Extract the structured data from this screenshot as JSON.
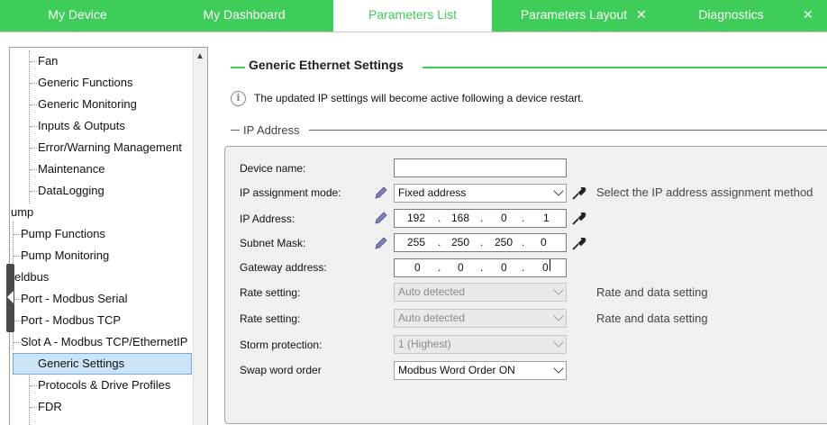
{
  "tabs": [
    {
      "label": "My Device",
      "active": false,
      "closable": false
    },
    {
      "label": "My Dashboard",
      "active": false,
      "closable": false
    },
    {
      "label": "Parameters List",
      "active": true,
      "closable": false
    },
    {
      "label": "Parameters Layout",
      "active": false,
      "closable": true
    },
    {
      "label": "Diagnostics",
      "active": false,
      "closable": true
    }
  ],
  "tree": {
    "items": [
      {
        "label": "Fan"
      },
      {
        "label": "Generic Functions"
      },
      {
        "label": "Generic Monitoring"
      },
      {
        "label": "Inputs & Outputs"
      },
      {
        "label": "Error/Warning Management"
      },
      {
        "label": "Maintenance"
      },
      {
        "label": "DataLogging"
      },
      {
        "label": "ump"
      },
      {
        "label": "Pump Functions"
      },
      {
        "label": "Pump Monitoring"
      },
      {
        "label": "eldbus"
      },
      {
        "label": "Port - Modbus Serial"
      },
      {
        "label": "Port - Modbus TCP"
      },
      {
        "label": "Slot A - Modbus TCP/EthernetIP"
      },
      {
        "label": "Generic Settings",
        "selected": true
      },
      {
        "label": "Protocols & Drive Profiles"
      },
      {
        "label": "FDR"
      }
    ]
  },
  "section": {
    "title": "Generic Ethernet Settings",
    "info": "The updated IP settings will become active following a device restart.",
    "subsection": "IP Address"
  },
  "form": {
    "device_name": {
      "label": "Device name:",
      "value": ""
    },
    "ip_mode": {
      "label": "IP assignment mode:",
      "value": "Fixed address",
      "hint": "Select the IP address assignment method"
    },
    "ip_address": {
      "label": "IP Address:",
      "octets": [
        "192",
        "168",
        "0",
        "1"
      ]
    },
    "subnet": {
      "label": "Subnet Mask:",
      "octets": [
        "255",
        "250",
        "250",
        "0"
      ]
    },
    "gateway": {
      "label": "Gateway address:",
      "octets": [
        "0",
        "0",
        "0",
        "0"
      ]
    },
    "rate1": {
      "label": "Rate setting:",
      "value": "Auto detected",
      "hint": "Rate and data setting"
    },
    "rate2": {
      "label": "Rate setting:",
      "value": "Auto detected",
      "hint": "Rate and data setting"
    },
    "storm": {
      "label": "Storm protection:",
      "value": "1 (Highest)"
    },
    "swap": {
      "label": "Swap word order",
      "value": "Modbus Word Order ON"
    }
  },
  "colors": {
    "accent": "#3dcd58",
    "selected": "#cce4f7"
  },
  "icons": [
    "close-icon",
    "info-icon",
    "pencil-icon",
    "wrench-icon",
    "chevron-down-icon",
    "scroll-up-icon",
    "collapse-arrow-icon"
  ]
}
